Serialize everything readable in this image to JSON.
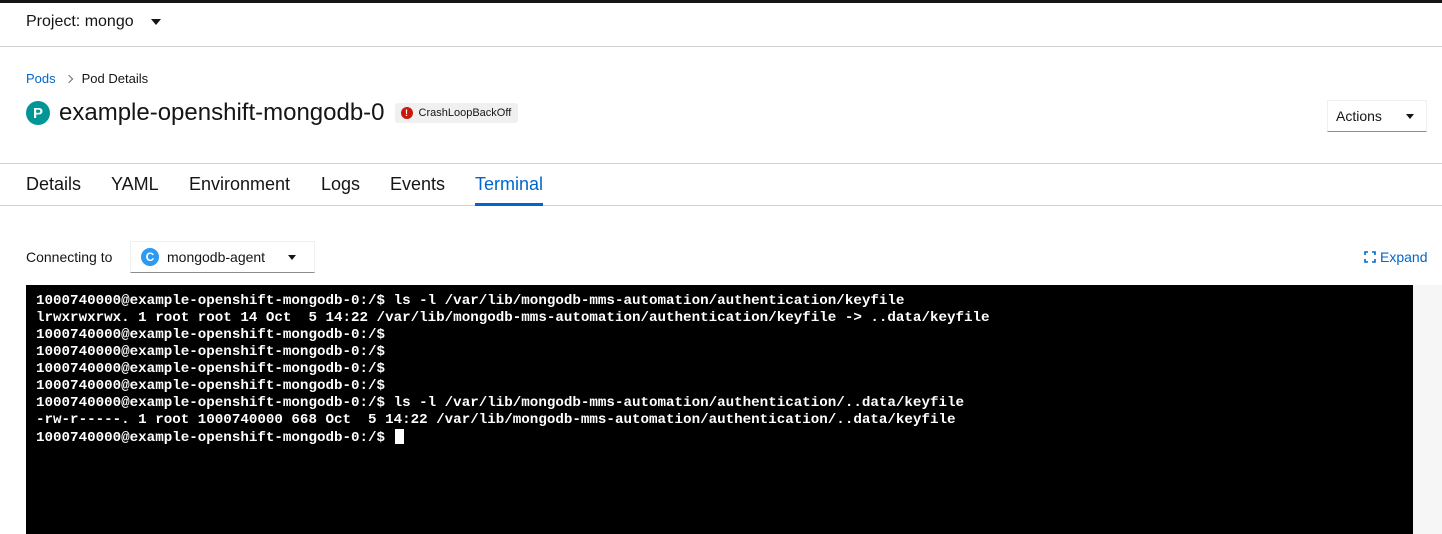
{
  "project_bar": {
    "label": "Project: mongo"
  },
  "breadcrumb": {
    "parent": "Pods",
    "current": "Pod Details"
  },
  "header": {
    "resource_badge": "P",
    "title": "example-openshift-mongodb-0",
    "status": "CrashLoopBackOff",
    "status_icon": "error-circle-icon",
    "actions_label": "Actions"
  },
  "tabs": [
    {
      "label": "Details"
    },
    {
      "label": "YAML"
    },
    {
      "label": "Environment"
    },
    {
      "label": "Logs"
    },
    {
      "label": "Events"
    },
    {
      "label": "Terminal"
    }
  ],
  "active_tab": "Terminal",
  "terminal_toolbar": {
    "connecting_label": "Connecting to",
    "container_badge": "C",
    "container_name": "mongodb-agent",
    "expand_label": "Expand"
  },
  "terminal": {
    "lines": [
      "1000740000@example-openshift-mongodb-0:/$ ls -l /var/lib/mongodb-mms-automation/authentication/keyfile",
      "lrwxrwxrwx. 1 root root 14 Oct  5 14:22 /var/lib/mongodb-mms-automation/authentication/keyfile -> ..data/keyfile",
      "1000740000@example-openshift-mongodb-0:/$",
      "1000740000@example-openshift-mongodb-0:/$",
      "1000740000@example-openshift-mongodb-0:/$",
      "1000740000@example-openshift-mongodb-0:/$",
      "1000740000@example-openshift-mongodb-0:/$ ls -l /var/lib/mongodb-mms-automation/authentication/..data/keyfile",
      "-rw-r-----. 1 root 1000740000 668 Oct  5 14:22 /var/lib/mongodb-mms-automation/authentication/..data/keyfile"
    ],
    "prompt": "1000740000@example-openshift-mongodb-0:/$ "
  },
  "colors": {
    "link_blue": "#0066cc",
    "pod_badge": "#009596",
    "container_badge": "#2b9af3",
    "error_red": "#c9190b",
    "terminal_bg": "#000000"
  }
}
